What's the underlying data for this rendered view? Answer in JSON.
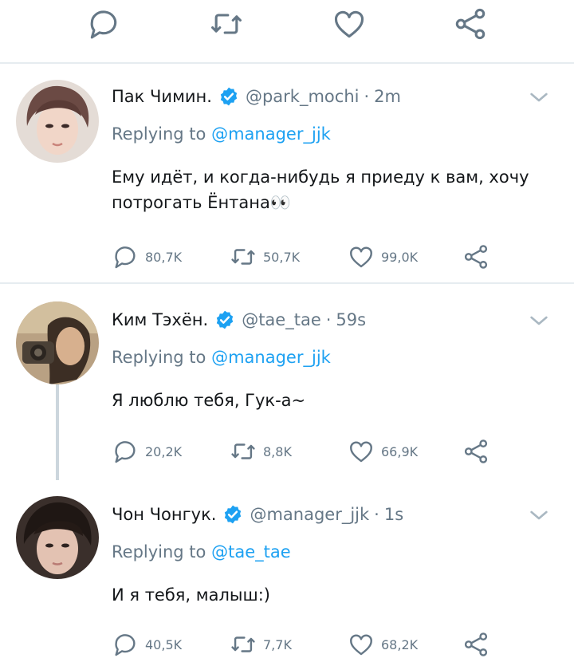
{
  "tweets": [
    {
      "name": "Пак Чимин.",
      "handle": "@park_mochi",
      "time": "2m",
      "reply_prefix": "Replying to",
      "reply_to": "@manager_jjk",
      "body": "Ему идёт, и когда-нибудь я приеду к вам, хочу потрогать Ёнтана👀",
      "replies": "80,7K",
      "retweets": "50,7K",
      "likes": "99,0K"
    },
    {
      "name": "Ким Тэхён.",
      "handle": "@tae_tae",
      "time": "59s",
      "reply_prefix": "Replying to",
      "reply_to": "@manager_jjk",
      "body": "Я люблю тебя, Гук-а~",
      "replies": "20,2K",
      "retweets": "8,8K",
      "likes": "66,9K"
    },
    {
      "name": "Чон Чонгук.",
      "handle": "@manager_jjk",
      "time": "1s",
      "reply_prefix": "Replying to",
      "reply_to": "@tae_tae",
      "body": "И я тебя, малыш:)",
      "replies": "40,5K",
      "retweets": "7,7K",
      "likes": "68,2K"
    }
  ],
  "icons": {
    "reply": "speech-bubble-icon",
    "retweet": "retweet-icon",
    "like": "heart-icon",
    "share": "share-icon",
    "verified": "verified-badge-icon",
    "chevron": "chevron-down-icon"
  },
  "colors": {
    "accent": "#1da1f2",
    "icon": "#657786",
    "text": "#14171a",
    "separator": "#e6ecf0"
  }
}
